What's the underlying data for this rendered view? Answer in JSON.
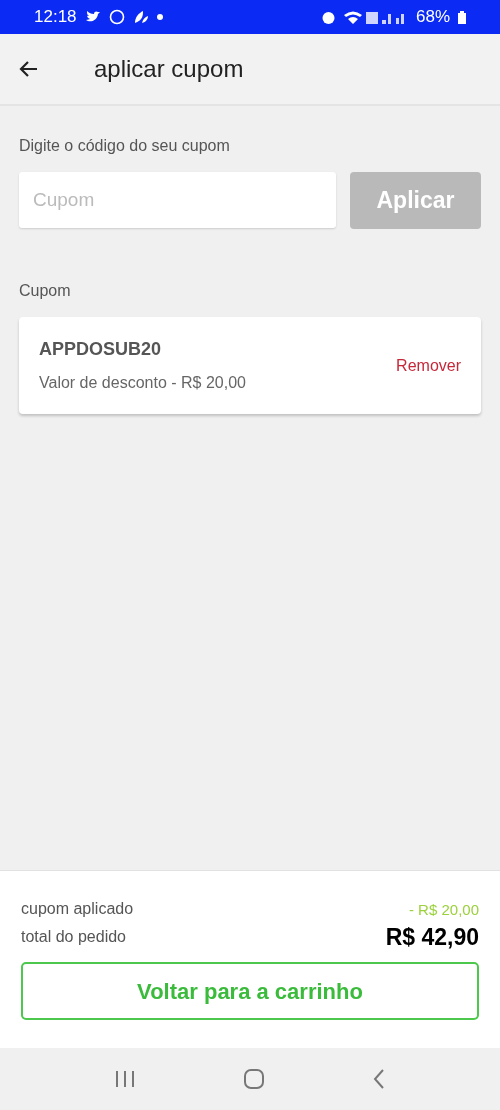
{
  "status_bar": {
    "time": "12:18",
    "battery": "68%"
  },
  "header": {
    "title": "aplicar cupom"
  },
  "coupon_form": {
    "label": "Digite o código do seu cupom",
    "placeholder": "Cupom",
    "apply_button": {
      "label": "Aplicar",
      "disabled": true
    }
  },
  "applied_section": {
    "title": "Cupom",
    "coupons": [
      {
        "code": "APPDOSUB20",
        "description": "Valor de desconto - R$ 20,00",
        "action": "Remover"
      }
    ]
  },
  "summary": {
    "rows": [
      {
        "label": "cupom aplicado",
        "value": "- R$ 20,00",
        "kind": "discount"
      },
      {
        "label": "total do pedido",
        "value": "R$ 42,90",
        "kind": "total"
      }
    ],
    "back_button": "Voltar para a carrinho"
  }
}
